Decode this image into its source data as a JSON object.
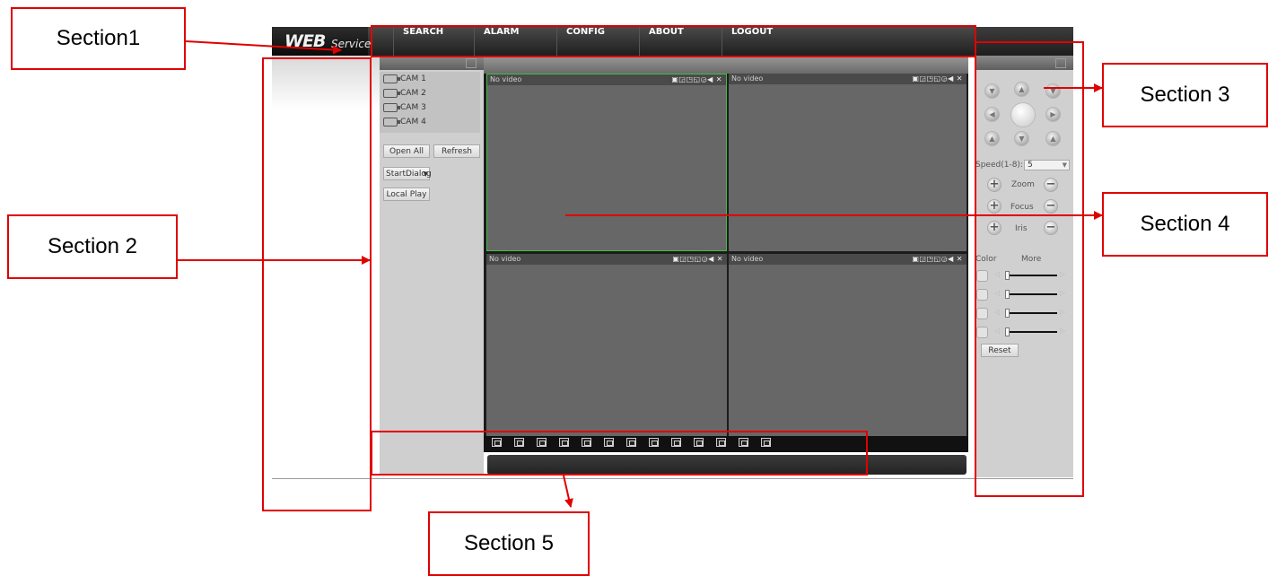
{
  "app": {
    "logo_main": "WEB",
    "logo_sub": "Service"
  },
  "menu": [
    {
      "label": "SEARCH"
    },
    {
      "label": "ALARM"
    },
    {
      "label": "CONFIG"
    },
    {
      "label": "ABOUT"
    },
    {
      "label": "LOGOUT"
    }
  ],
  "left_panel": {
    "cameras": [
      "CAM 1",
      "CAM 2",
      "CAM 3",
      "CAM 4"
    ],
    "open_all": "Open All",
    "refresh": "Refresh",
    "start_dialog": "StartDialog",
    "local_play": "Local Play"
  },
  "video": {
    "no_video": [
      "No video",
      "No video",
      "No video",
      "No video"
    ],
    "pane_controls": "▣◲◳◱◶◀ ✕"
  },
  "ptz": {
    "speed_label": "Speed(1-8):",
    "speed_value": "5",
    "zoom": "Zoom",
    "focus": "Focus",
    "iris": "Iris",
    "tab_color": "Color",
    "tab_more": "More",
    "reset": "Reset"
  },
  "annotations": {
    "section1": "Section1",
    "section2": "Section 2",
    "section3": "Section 3",
    "section4": "Section 4",
    "section5": "Section 5"
  },
  "colors": {
    "annotation": "#e00000",
    "selected_pane": "#3fbf3f"
  }
}
